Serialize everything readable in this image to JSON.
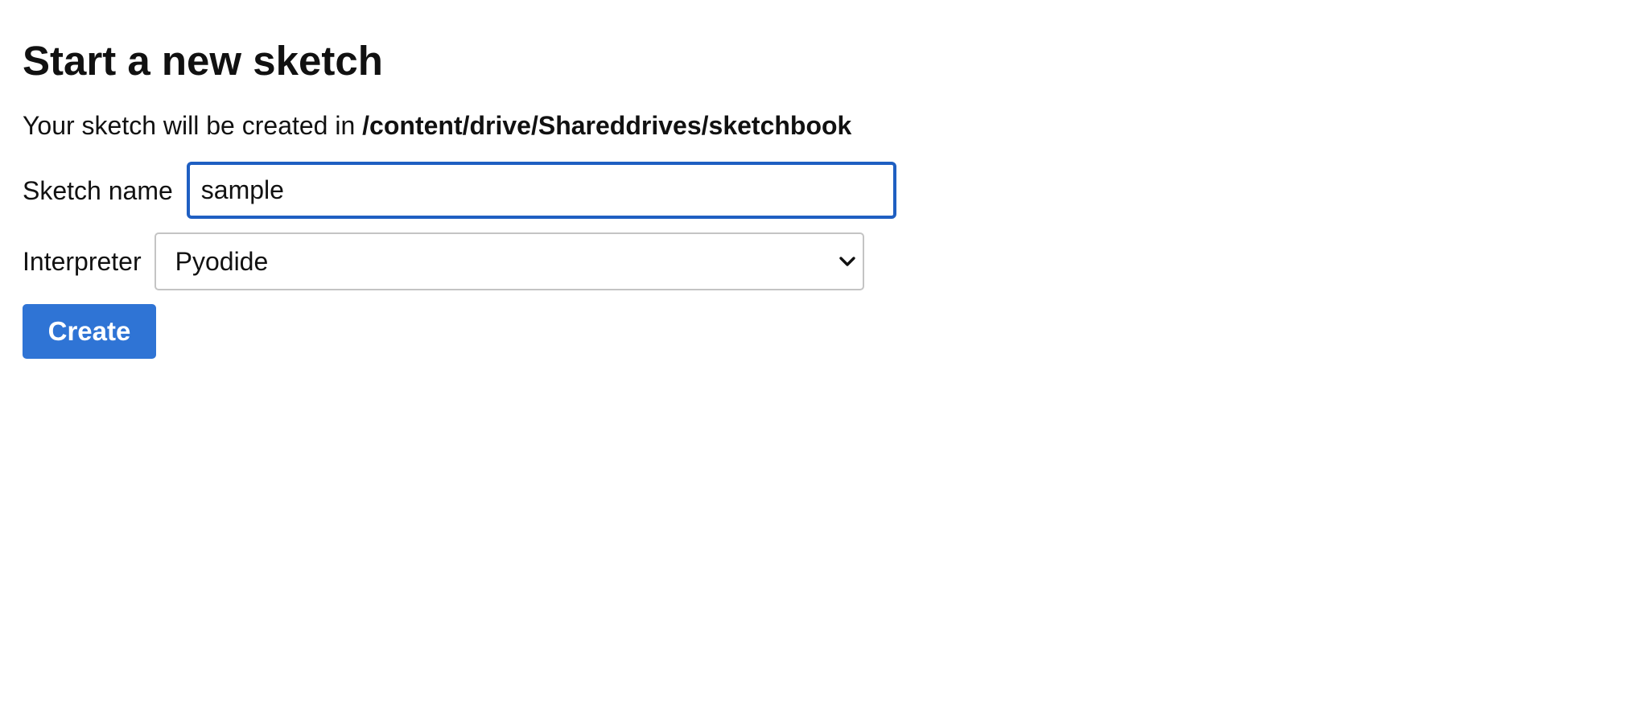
{
  "page": {
    "title": "Start a new sketch",
    "location_prefix": "Your sketch will be created in",
    "location_path": "/content/drive/Shareddrives/sketchbook"
  },
  "form": {
    "sketch_name": {
      "label": "Sketch name",
      "value": "sample",
      "focused": true
    },
    "interpreter": {
      "label": "Interpreter",
      "selected": "Pyodide",
      "icon": "chevron-down-icon"
    },
    "create_button": {
      "label": "Create",
      "color": "#2f74d5"
    }
  },
  "colors": {
    "focus_border": "#1f5fc2",
    "text": "#111111",
    "background": "#ffffff"
  }
}
